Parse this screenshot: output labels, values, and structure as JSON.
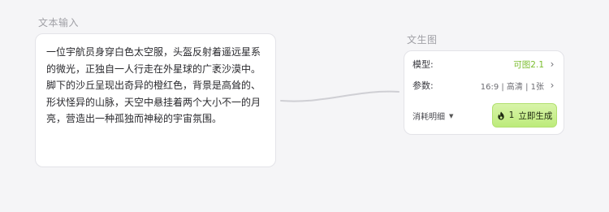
{
  "input_node": {
    "title": "文本输入",
    "prompt": "一位宇航员身穿白色太空服，头盔反射着遥远星系的微光，正独自一人行走在外星球的广袤沙漠中。脚下的沙丘呈现出奇异的橙红色，背景是高耸的、形状怪异的山脉，天空中悬挂着两个大小不一的月亮，营造出一种孤独而神秘的宇宙氛围。"
  },
  "t2i_node": {
    "title": "文生图",
    "model_label": "模型:",
    "model_value": "可图2.1",
    "params_label": "参数:",
    "params_value": "16:9 | 高清 | 1张",
    "cost_label": "消耗明细",
    "generate_count": "1",
    "generate_label": "立即生成"
  },
  "colors": {
    "accent_green": "#7bbd2e",
    "button_bg": "#c6ee8a",
    "background": "#f5f5f7"
  },
  "icons": {
    "chevron": "chevron-right-icon",
    "caret": "caret-down-icon",
    "flame": "flame-icon"
  }
}
